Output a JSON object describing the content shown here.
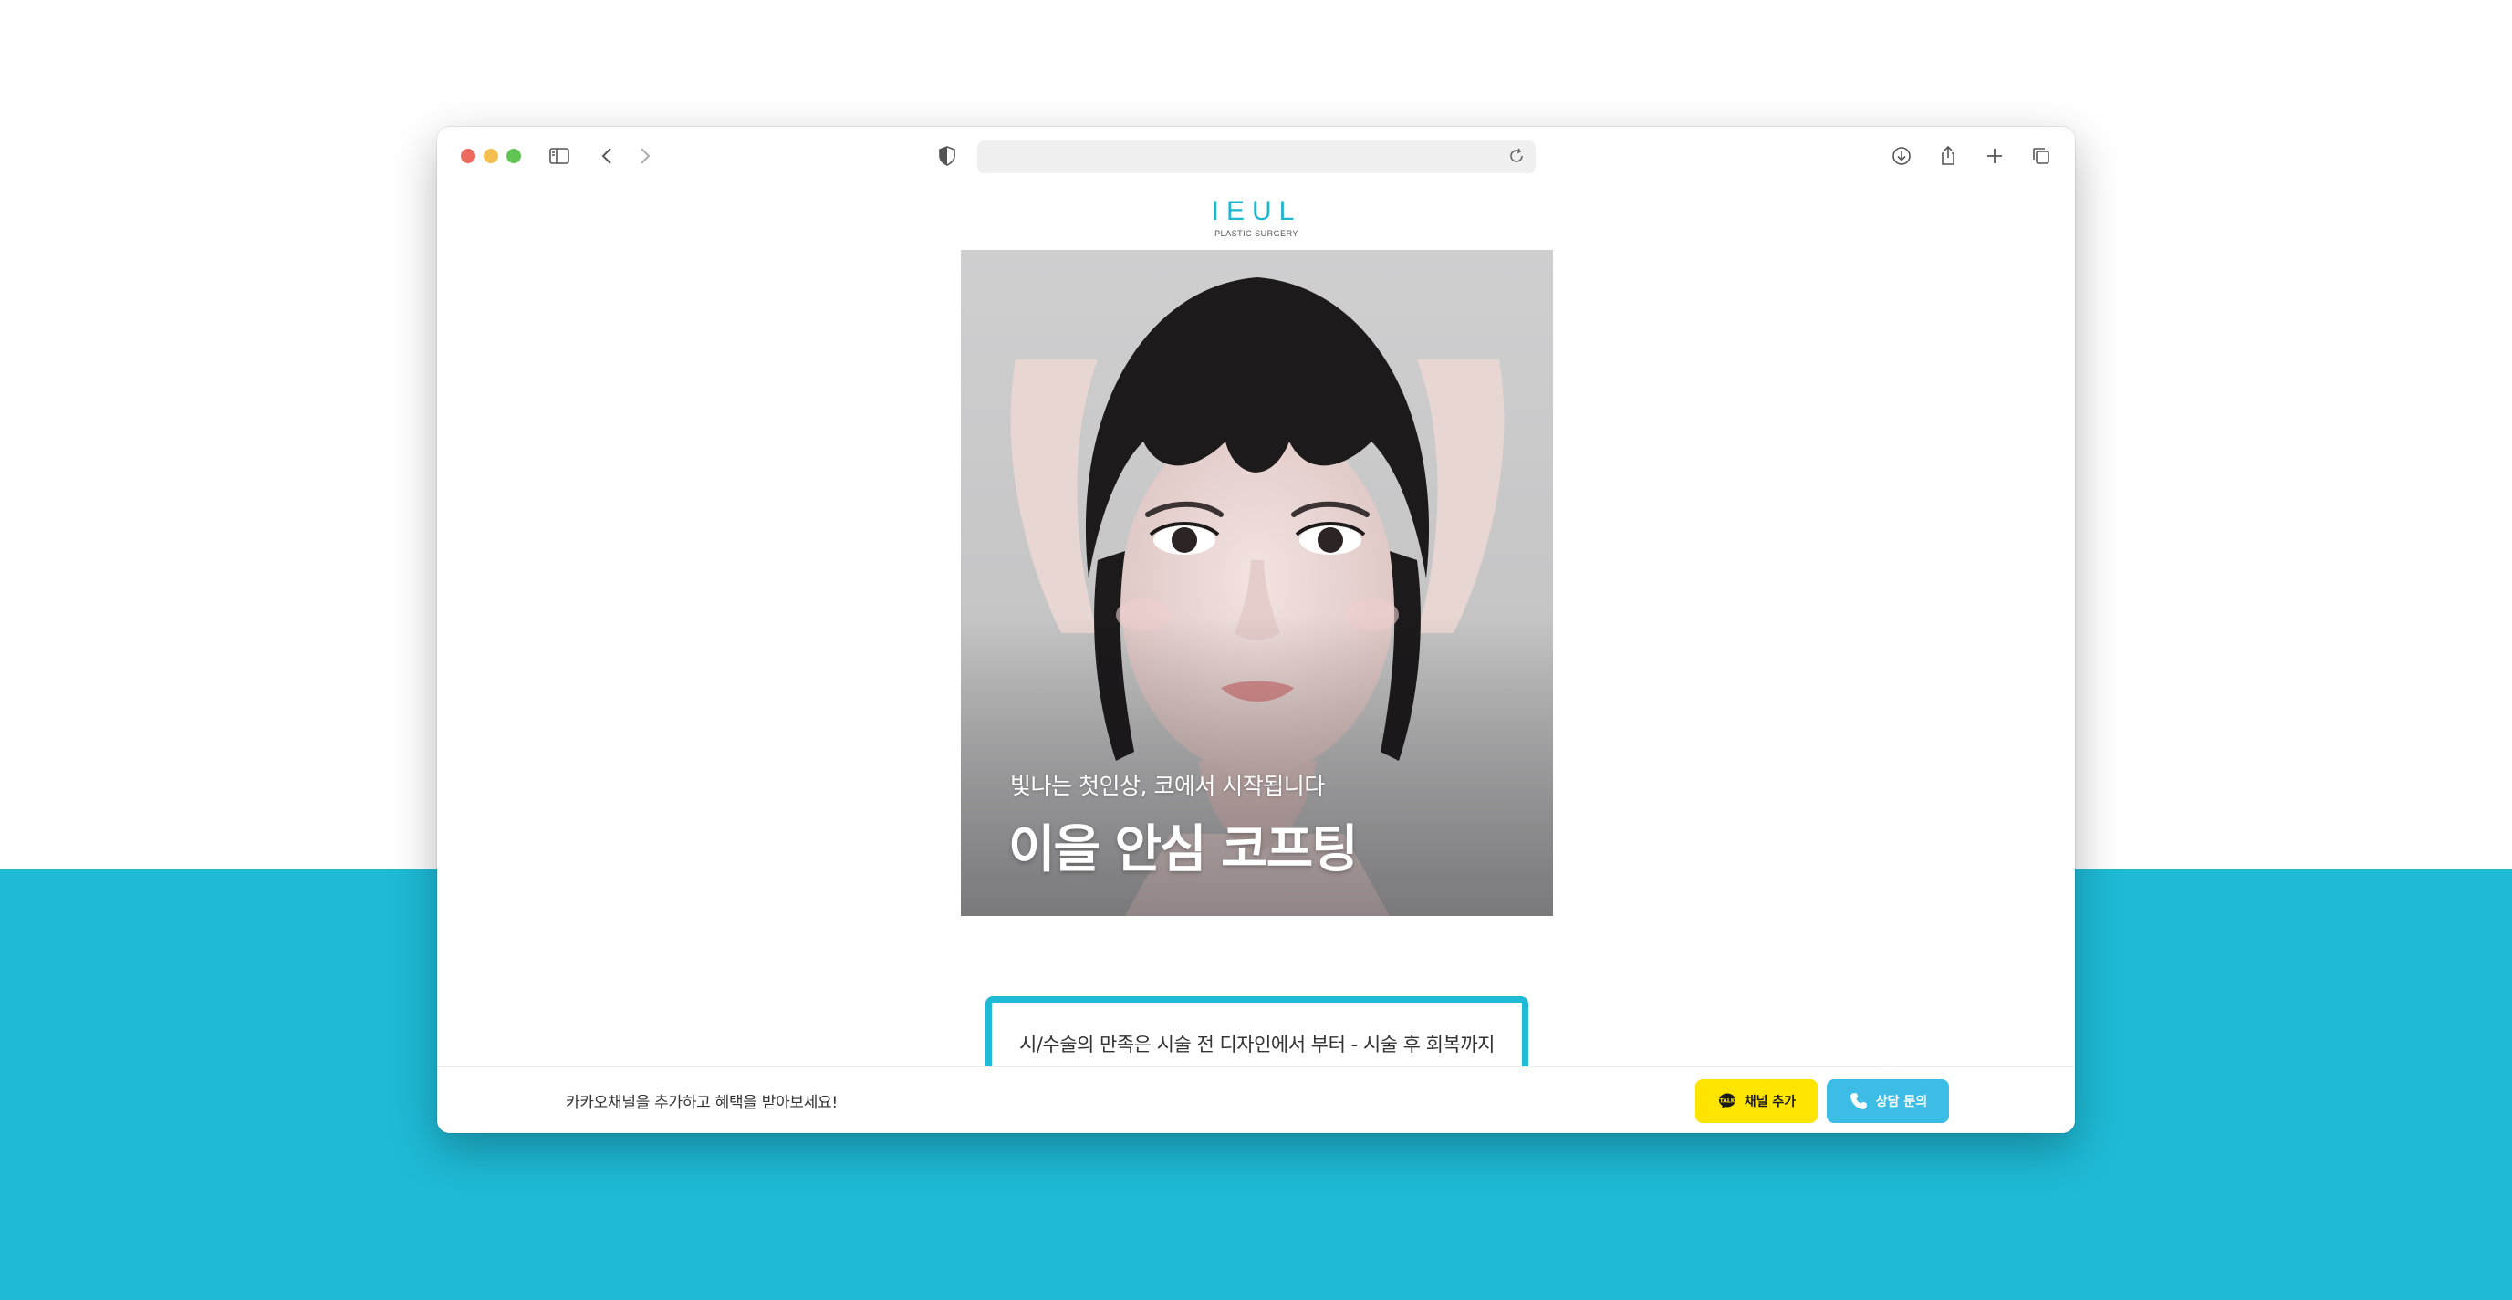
{
  "browser": {
    "icons": [
      "sidebar-icon",
      "back-icon",
      "forward-icon",
      "shield-icon",
      "reload-icon",
      "download-icon",
      "share-icon",
      "new-tab-icon",
      "tabs-overview-icon"
    ]
  },
  "site": {
    "logo_text": "IEUL",
    "logo_subtitle": "PLASTIC SURGERY"
  },
  "hero": {
    "subtitle": "빛나는 첫인상, 코에서 시작됩니다",
    "title": "이을 안심 코프팅"
  },
  "info": {
    "line1": "시/수술의 만족은 시술 전 디자인에서 부터 - 시술 후 회복까지",
    "line2": ""
  },
  "bottom_bar": {
    "message": "카카오채널을 추가하고 혜택을 받아보세요!",
    "kakao_button": "채널 추가",
    "consult_button": "상담 문의"
  },
  "colors": {
    "accent": "#1ebad6",
    "kakao": "#fee500",
    "consult": "#3dbde6"
  }
}
